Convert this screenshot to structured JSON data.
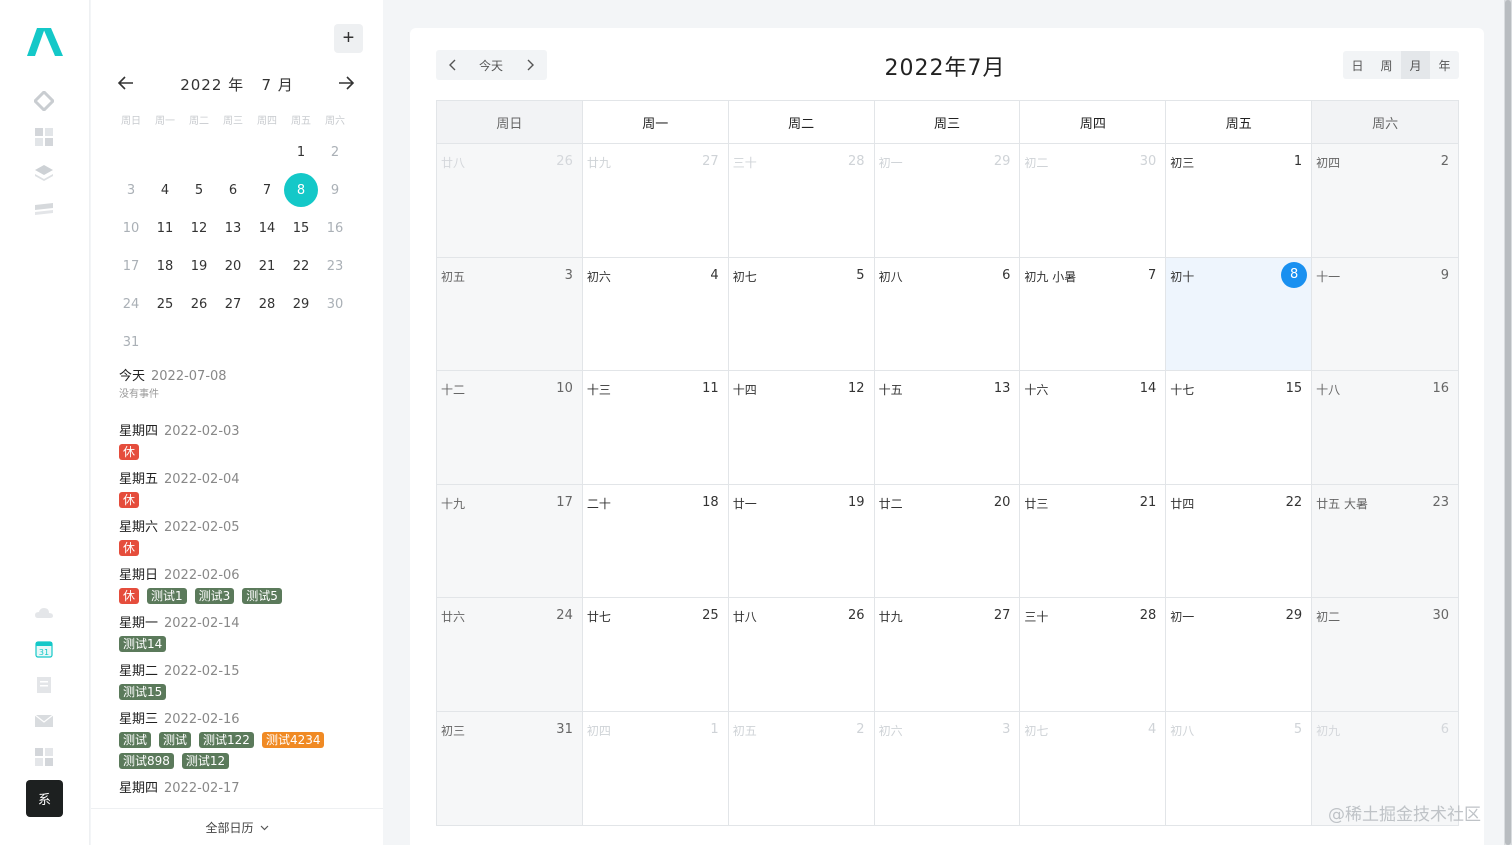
{
  "rail": {
    "avatar_text": "系",
    "calendar_badge": "31",
    "colors": {
      "brand": "#14c8c8",
      "avatar_bg": "#1d2020"
    }
  },
  "sidebar": {
    "add_label": "+",
    "mini_calendar": {
      "title": "2022 年   7 月",
      "weekdays": [
        "周日",
        "周一",
        "周二",
        "周三",
        "周四",
        "周五",
        "周六"
      ],
      "selected": 8
    },
    "agenda": {
      "today_label": "今天",
      "today_date": "2022-07-08",
      "no_events": "没有事件",
      "days": [
        {
          "weekday": "星期四",
          "date": "2022-02-03",
          "tags": [
            {
              "t": "休",
              "c": "rest"
            }
          ]
        },
        {
          "weekday": "星期五",
          "date": "2022-02-04",
          "tags": [
            {
              "t": "休",
              "c": "rest"
            }
          ]
        },
        {
          "weekday": "星期六",
          "date": "2022-02-05",
          "tags": [
            {
              "t": "休",
              "c": "rest"
            }
          ]
        },
        {
          "weekday": "星期日",
          "date": "2022-02-06",
          "tags": [
            {
              "t": "休",
              "c": "rest"
            },
            {
              "t": "测试1",
              "c": "g"
            },
            {
              "t": "测试3",
              "c": "g"
            },
            {
              "t": "测试5",
              "c": "g"
            }
          ]
        },
        {
          "weekday": "星期一",
          "date": "2022-02-14",
          "tags": [
            {
              "t": "测试14",
              "c": "g"
            }
          ]
        },
        {
          "weekday": "星期二",
          "date": "2022-02-15",
          "tags": [
            {
              "t": "测试15",
              "c": "g"
            }
          ]
        },
        {
          "weekday": "星期三",
          "date": "2022-02-16",
          "tags": [
            {
              "t": "测试",
              "c": "g"
            },
            {
              "t": "测试",
              "c": "g"
            },
            {
              "t": "测试122",
              "c": "g"
            },
            {
              "t": "测试4234",
              "c": "o"
            },
            {
              "t": "测试898",
              "c": "g"
            },
            {
              "t": "测试12",
              "c": "g"
            }
          ]
        },
        {
          "weekday": "星期四",
          "date": "2022-02-17",
          "tags": []
        }
      ]
    },
    "footer_label": "全部日历"
  },
  "main": {
    "today_label": "今天",
    "title": "2022年7月",
    "views": [
      "日",
      "周",
      "月",
      "年"
    ],
    "active_view": "月",
    "weekdays": [
      "周日",
      "周一",
      "周二",
      "周三",
      "周四",
      "周五",
      "周六"
    ],
    "weeks": [
      [
        [
          "廿八",
          "26",
          1
        ],
        [
          "廿九",
          "27",
          1
        ],
        [
          "三十",
          "28",
          1
        ],
        [
          "初一",
          "29",
          1
        ],
        [
          "初二",
          "30",
          1
        ],
        [
          "初三",
          "1",
          0
        ],
        [
          "初四",
          "2",
          0
        ]
      ],
      [
        [
          "初五",
          "3",
          0
        ],
        [
          "初六",
          "4",
          0
        ],
        [
          "初七",
          "5",
          0
        ],
        [
          "初八",
          "6",
          0
        ],
        [
          "初九 小暑",
          "7",
          0
        ],
        [
          "初十",
          "8",
          2
        ],
        [
          "十一",
          "9",
          0
        ]
      ],
      [
        [
          "十二",
          "10",
          0
        ],
        [
          "十三",
          "11",
          0
        ],
        [
          "十四",
          "12",
          0
        ],
        [
          "十五",
          "13",
          0
        ],
        [
          "十六",
          "14",
          0
        ],
        [
          "十七",
          "15",
          0
        ],
        [
          "十八",
          "16",
          0
        ]
      ],
      [
        [
          "十九",
          "17",
          0
        ],
        [
          "二十",
          "18",
          0
        ],
        [
          "廿一",
          "19",
          0
        ],
        [
          "廿二",
          "20",
          0
        ],
        [
          "廿三",
          "21",
          0
        ],
        [
          "廿四",
          "22",
          0
        ],
        [
          "廿五 大暑",
          "23",
          0
        ]
      ],
      [
        [
          "廿六",
          "24",
          0
        ],
        [
          "廿七",
          "25",
          0
        ],
        [
          "廿八",
          "26",
          0
        ],
        [
          "廿九",
          "27",
          0
        ],
        [
          "三十",
          "28",
          0
        ],
        [
          "初一",
          "29",
          0
        ],
        [
          "初二",
          "30",
          0
        ]
      ],
      [
        [
          "初三",
          "31",
          0
        ],
        [
          "初四",
          "1",
          1
        ],
        [
          "初五",
          "2",
          1
        ],
        [
          "初六",
          "3",
          1
        ],
        [
          "初七",
          "4",
          1
        ],
        [
          "初八",
          "5",
          1
        ],
        [
          "初九",
          "6",
          1
        ]
      ]
    ],
    "colors": {
      "today_circle": "#1990f0",
      "today_bg": "#eef5fd"
    }
  },
  "watermark": "@稀土掘金技术社区"
}
